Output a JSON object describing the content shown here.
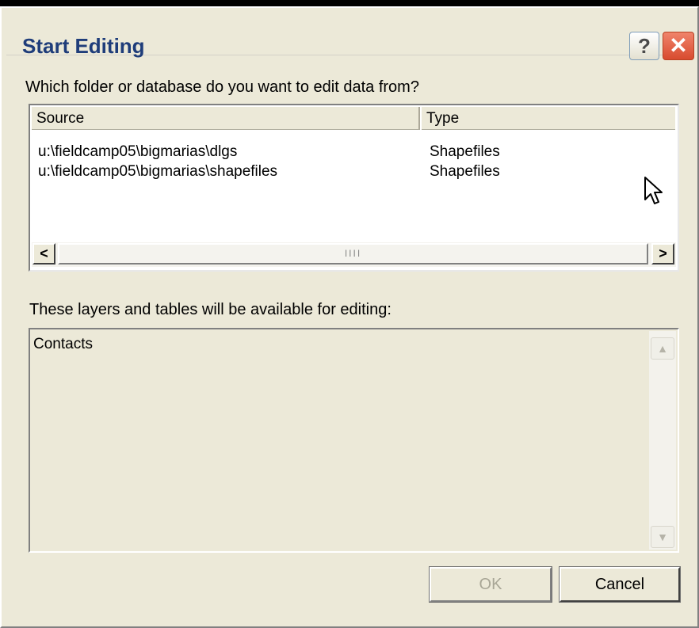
{
  "dialog": {
    "title": "Start Editing",
    "help_label": "?",
    "close_label": "✕"
  },
  "source_section": {
    "question": "Which folder or database do you want to edit data from?",
    "columns": [
      "Source",
      "Type"
    ],
    "rows": [
      {
        "source": "u:\\fieldcamp05\\bigmarias\\dlgs",
        "type": "Shapefiles"
      },
      {
        "source": "u:\\fieldcamp05\\bigmarias\\shapefiles",
        "type": "Shapefiles"
      }
    ],
    "scroll_left": "<",
    "scroll_right": ">",
    "scroll_grip": "IIII"
  },
  "layers_section": {
    "label": "These layers and tables will be available for editing:",
    "items": [
      "Contacts"
    ],
    "scroll_up": "▲",
    "scroll_down": "▼"
  },
  "buttons": {
    "ok": "OK",
    "ok_enabled": false,
    "cancel": "Cancel"
  },
  "icons": {
    "help": "help-icon",
    "close": "close-icon",
    "cursor": "mouse-pointer-icon"
  },
  "colors": {
    "dialog_bg": "#ECE9D8",
    "title_text": "#1F3D7A",
    "close_button": "#D84B2F"
  }
}
